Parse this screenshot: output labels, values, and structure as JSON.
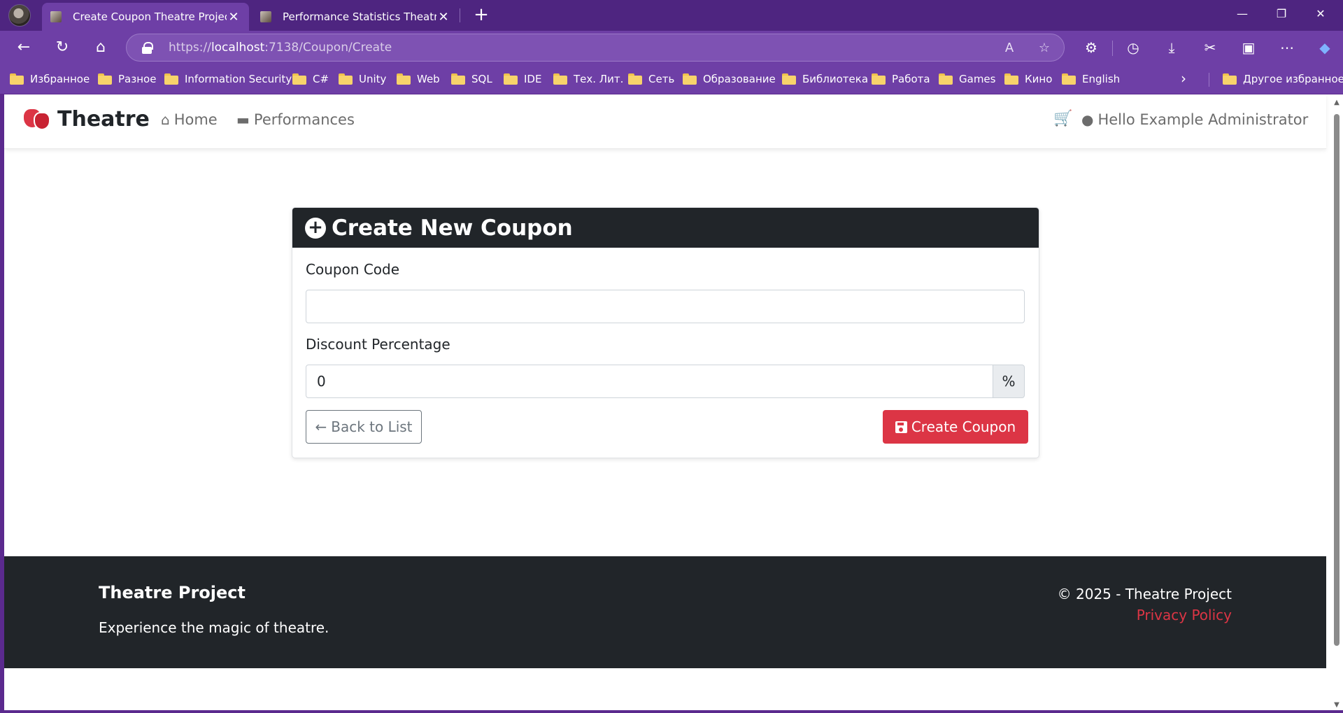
{
  "browser": {
    "tabs": [
      {
        "title": "Create Coupon Theatre Project",
        "active": true
      },
      {
        "title": "Performance Statistics Theatre Pro",
        "active": false
      }
    ],
    "address": {
      "scheme": "https://",
      "host": "localhost",
      "path": ":7138/Coupon/Create"
    },
    "bookmarks": [
      "Избранное",
      "Разное",
      "Information Security",
      "C#",
      "Unity",
      "Web",
      "SQL",
      "IDE",
      "Тех. Лит.",
      "Сеть",
      "Образование",
      "Библиотека",
      "Работа",
      "Games",
      "Кино",
      "English"
    ],
    "other_bookmarks": "Другое избранное",
    "accent": "#6e3fa6"
  },
  "site": {
    "brand": "Theatre",
    "nav": {
      "home": "Home",
      "performances": "Performances"
    },
    "user": "Hello Example Administrator"
  },
  "form": {
    "title": "Create New Coupon",
    "coupon_code_label": "Coupon Code",
    "coupon_code_value": "",
    "discount_label": "Discount Percentage",
    "discount_value": "0",
    "discount_suffix": "%",
    "back_button": "Back to List",
    "create_button": "Create Coupon"
  },
  "footer": {
    "title": "Theatre Project",
    "tagline": "Experience the magic of theatre.",
    "copyright": "© 2025 - Theatre Project",
    "privacy": "Privacy Policy"
  },
  "colors": {
    "primary": "#dc3545",
    "dark": "#212529"
  }
}
